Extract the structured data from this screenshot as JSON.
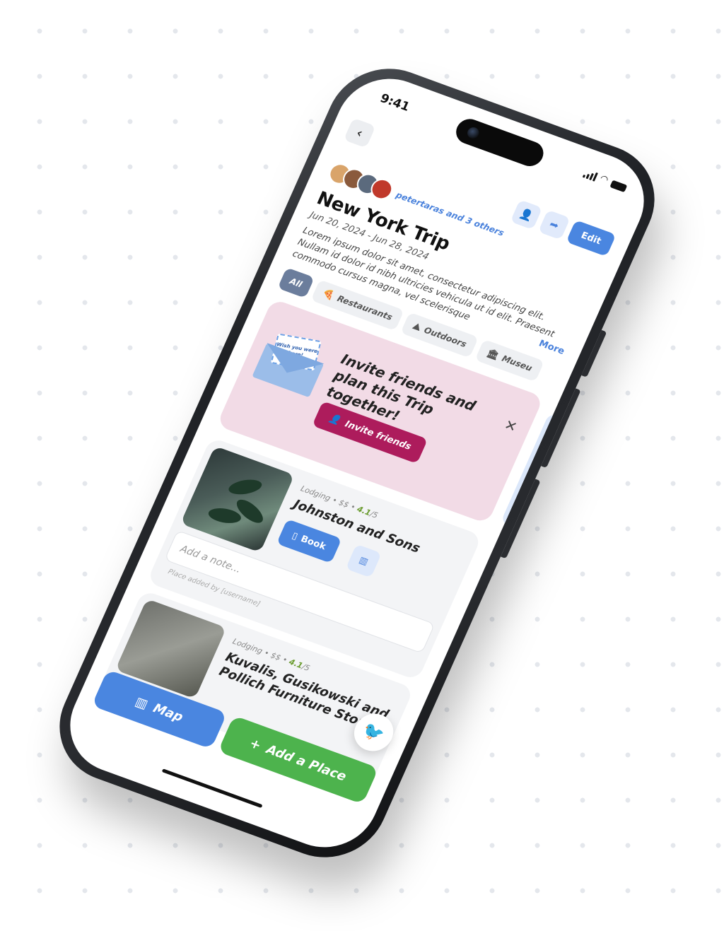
{
  "status": {
    "time": "9:41"
  },
  "header": {
    "back_icon": "chevron-left-icon",
    "edit_label": "Edit"
  },
  "trip": {
    "collaborators_text": "petertaras and 3 others",
    "title": "New York Trip",
    "dates": "Jun 20, 2024 - Jun 28, 2024",
    "description": "Lorem ipsum dolor sit amet, consectetur adipiscing elit. Nullam id dolor id nibh ultricies vehicula ut id elit. Praesent commodo cursus magna, vel scelerisque",
    "more_label": "More"
  },
  "filters": [
    {
      "label": "All",
      "icon": "",
      "active": true
    },
    {
      "label": "Restaurants",
      "icon": "pizza-icon",
      "active": false
    },
    {
      "label": "Outdoors",
      "icon": "mountain-icon",
      "active": false
    },
    {
      "label": "Museu",
      "icon": "museum-icon",
      "active": false
    }
  ],
  "invite": {
    "card_text": "Wish you were here!",
    "title": "Invite friends and plan this Trip together!",
    "button_label": "Invite friends"
  },
  "places": [
    {
      "category": "Lodging",
      "price": "$$",
      "rating": "4.1",
      "rating_suffix": "/5",
      "name": "Johnston and Sons",
      "book_label": "Book",
      "note_placeholder": "Add a note...",
      "added_by": "Place added by [username]"
    },
    {
      "category": "Lodging",
      "price": "$$",
      "rating": "4.1",
      "rating_suffix": "/5",
      "name": "Kuvalis, Gusikowski and Pollich Furniture Store a"
    }
  ],
  "bottom": {
    "map_label": "Map",
    "add_label": "Add a Place"
  },
  "colors": {
    "primary": "#4a86e0",
    "invite_bg": "#f2dbe6",
    "invite_button": "#ad1c5c",
    "add_button": "#4db34d",
    "active_chip": "#6b7d9c"
  }
}
